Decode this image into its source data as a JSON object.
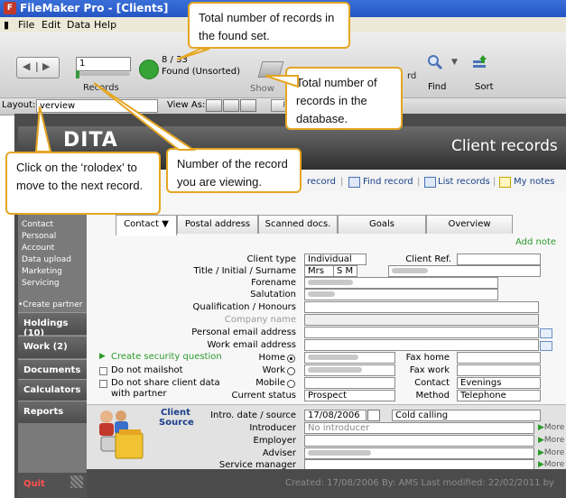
{
  "window": {
    "title": "FileMaker Pro - [Clients]",
    "app_icon": "filemaker-icon"
  },
  "menu": [
    "File",
    "Edit",
    "Data",
    "Help"
  ],
  "toolbar": {
    "record_input": "1",
    "records_label": "Records",
    "count": "8 / 33",
    "found_status": "Found (Unsorted)",
    "show_all_label": "Show",
    "record_label": "rd",
    "find_label": "Find",
    "sort_label": "Sort"
  },
  "layoutbar": {
    "layout_label": "Layout:",
    "layout_value": "verview",
    "view_as_label": "View As:",
    "preview": "P"
  },
  "header": {
    "brand": "DITA",
    "title": "Client records"
  },
  "actions": {
    "new_record": "record",
    "find_record": "Find record",
    "list_records": "List records",
    "my_notes": "My notes"
  },
  "sidebar": {
    "sub_items": [
      "Contact",
      "Personal",
      "Account",
      "Data upload",
      "Marketing",
      "Servicing",
      "",
      "•Create partner"
    ],
    "sections": [
      "Holdings (10)",
      "Work (2)",
      "Documents",
      "Calculators",
      "Reports"
    ],
    "quit": "Quit"
  },
  "tabs": [
    "Contact ▼",
    "Postal address",
    "Scanned docs.",
    "Goals",
    "Overview"
  ],
  "add_note": "Add note",
  "form": {
    "client_type_label": "Client type",
    "client_type": "Individual",
    "client_ref_label": "Client Ref.",
    "title_label": "Title / Initial / Surname",
    "title": "Mrs",
    "initials": "S M",
    "forename_label": "Forename",
    "salutation_label": "Salutation",
    "qualification_label": "Qualification / Honours",
    "company_label": "Company name",
    "personal_email_label": "Personal email address",
    "work_email_label": "Work email address",
    "create_security": "Create security question",
    "home_label": "Home",
    "work_label": "Work",
    "mobile_label": "Mobile",
    "fax_home_label": "Fax home",
    "fax_work_label": "Fax work",
    "contact_label": "Contact",
    "contact": "Evenings",
    "method_label": "Method",
    "method": "Telephone",
    "do_not_mailshot": "Do not mailshot",
    "do_not_share": "Do not share client data",
    "with_partner": "with partner",
    "current_status_label": "Current status",
    "current_status": "Prospect"
  },
  "source": {
    "section_label_1": "Client",
    "section_label_2": "Source",
    "intro_label": "Intro. date / source",
    "intro_date": "17/08/2006",
    "intro_source": "Cold calling",
    "introducer_label": "Introducer",
    "introducer": "No introducer",
    "employer_label": "Employer",
    "adviser_label": "Adviser",
    "service_manager_label": "Service manager",
    "more": "More"
  },
  "footer": "Created: 17/08/2006  By: AMS  Last modified: 22/02/2011 by",
  "callouts": {
    "found_set": "Total number of records in the found set.",
    "total_db": "Total number of records in the database.",
    "rolodex": "Click on the ‘rolodex’ to move to the next record.",
    "viewing": "Number of the record you are viewing."
  },
  "colors": {
    "callout_border": "#e5a623",
    "accent_green": "#2a9b2a",
    "quit_red": "#ff5050"
  }
}
